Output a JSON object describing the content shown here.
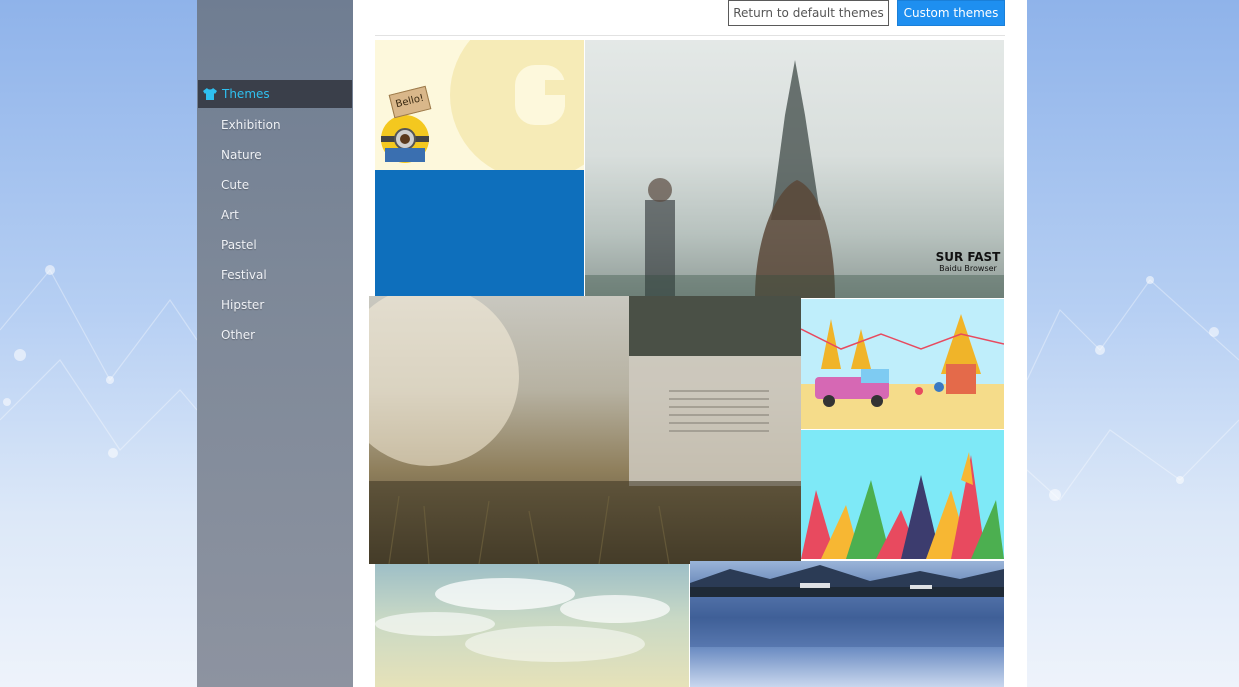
{
  "sidebar": {
    "items": [
      {
        "label": "Themes",
        "active": true
      },
      {
        "label": "Exhibition"
      },
      {
        "label": "Nature"
      },
      {
        "label": "Cute"
      },
      {
        "label": "Art"
      },
      {
        "label": "Pastel"
      },
      {
        "label": "Festival"
      },
      {
        "label": "Hipster"
      },
      {
        "label": "Other"
      }
    ]
  },
  "toolbar": {
    "return_default_label": "Return to default themes",
    "custom_label": "Custom themes"
  },
  "themes": {
    "minion_sign": "Bello!",
    "city_brand_title": "SUR FAST",
    "city_brand_subtitle": "Baidu  Browser"
  },
  "colors": {
    "accent_blue": "#1e8ff0",
    "active_text": "#2fc0f0",
    "solid_tile": "#0e6fbc"
  }
}
